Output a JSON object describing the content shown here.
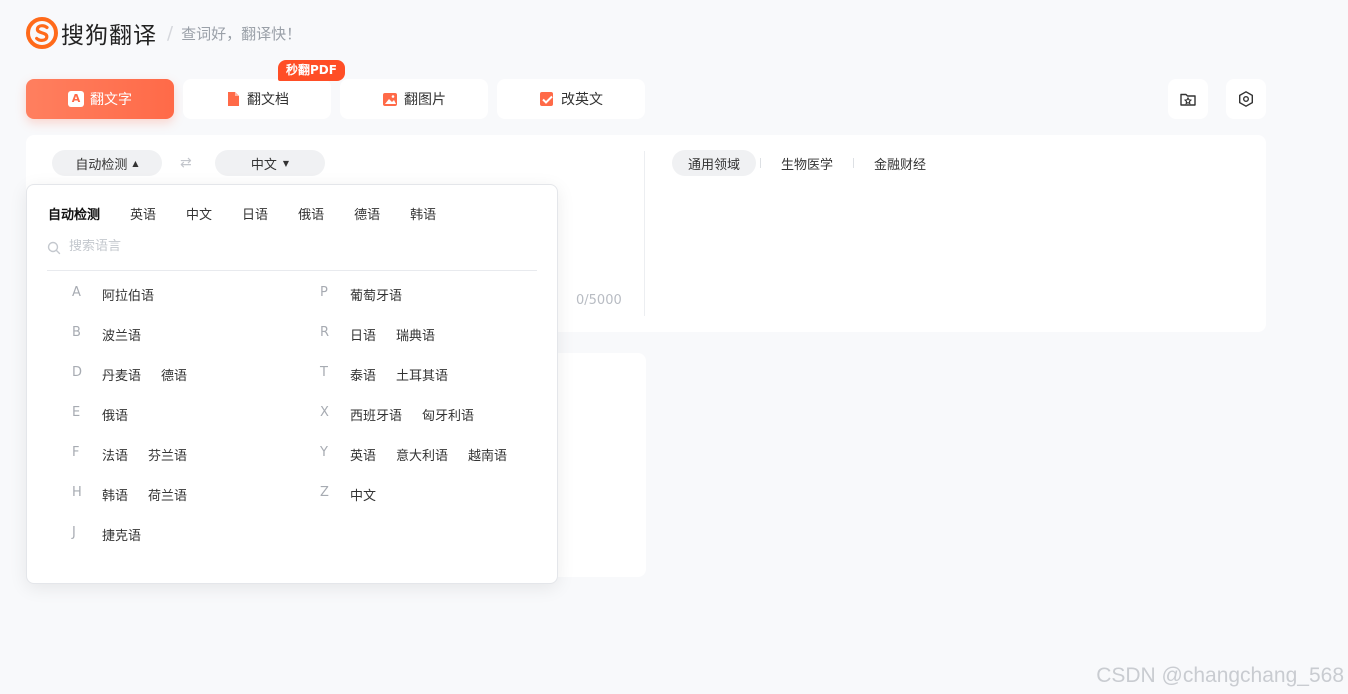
{
  "header": {
    "logo_text": "搜狗翻译",
    "slogan": "查词好，翻译快！"
  },
  "tabs": [
    {
      "label": "翻文字",
      "icon": "text-icon",
      "active": true
    },
    {
      "label": "翻文档",
      "icon": "document-icon",
      "active": false
    },
    {
      "label": "翻图片",
      "icon": "image-icon",
      "active": false
    },
    {
      "label": "改英文",
      "icon": "edit-check-icon",
      "active": false
    }
  ],
  "pdf_badge": "秒翻PDF",
  "tab_active_letter": "A",
  "source": {
    "language": "自动检测",
    "target_language": "中文",
    "counter": "0/5000"
  },
  "domains": [
    {
      "label": "通用领域",
      "active": true
    },
    {
      "label": "生物医学",
      "active": false
    },
    {
      "label": "金融财经",
      "active": false
    }
  ],
  "dropdown": {
    "quick_langs": [
      "自动检测",
      "英语",
      "中文",
      "日语",
      "俄语",
      "德语",
      "韩语"
    ],
    "search_placeholder": "搜索语言",
    "left_groups": [
      {
        "letter": "A",
        "langs": [
          "阿拉伯语"
        ]
      },
      {
        "letter": "B",
        "langs": [
          "波兰语"
        ]
      },
      {
        "letter": "D",
        "langs": [
          "丹麦语",
          "德语"
        ]
      },
      {
        "letter": "E",
        "langs": [
          "俄语"
        ]
      },
      {
        "letter": "F",
        "langs": [
          "法语",
          "芬兰语"
        ]
      },
      {
        "letter": "H",
        "langs": [
          "韩语",
          "荷兰语"
        ]
      },
      {
        "letter": "J",
        "langs": [
          "捷克语"
        ]
      }
    ],
    "right_groups": [
      {
        "letter": "P",
        "langs": [
          "葡萄牙语"
        ]
      },
      {
        "letter": "R",
        "langs": [
          "日语",
          "瑞典语"
        ]
      },
      {
        "letter": "T",
        "langs": [
          "泰语",
          "土耳其语"
        ]
      },
      {
        "letter": "X",
        "langs": [
          "西班牙语",
          "匈牙利语"
        ]
      },
      {
        "letter": "Y",
        "langs": [
          "英语",
          "意大利语",
          "越南语"
        ]
      },
      {
        "letter": "Z",
        "langs": [
          "中文"
        ]
      }
    ]
  },
  "watermark": "CSDN @changchang_568",
  "colors": {
    "accent": "#ff6a48",
    "badge": "#ff4e26"
  }
}
